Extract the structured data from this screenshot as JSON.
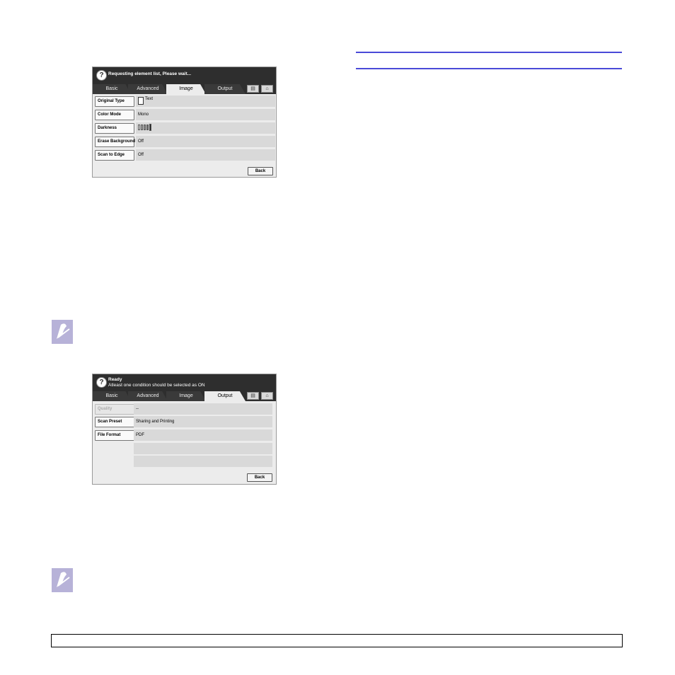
{
  "screen1": {
    "message": "Requesting element list, Please wait...",
    "tabs": [
      "Basic",
      "Advanced",
      "Image",
      "Output"
    ],
    "rows": [
      {
        "label": "Original Type",
        "value": "Text"
      },
      {
        "label": "Color Mode",
        "value": "Mono"
      },
      {
        "label": "Darkness",
        "value": ""
      },
      {
        "label": "Erase Background",
        "value": "Off"
      },
      {
        "label": "Scan to Edge",
        "value": "Off"
      }
    ],
    "back": "Back"
  },
  "screen2": {
    "status": "Ready",
    "message": "Atleast one condition should be selected as ON",
    "tabs": [
      "Basic",
      "Advanced",
      "Image",
      "Output"
    ],
    "rows": [
      {
        "label": "Quality",
        "value": "--"
      },
      {
        "label": "Scan Preset",
        "value": "Sharing and Printing"
      },
      {
        "label": "File Format",
        "value": "PDF"
      }
    ],
    "back": "Back"
  },
  "icons": [
    "help-icon",
    "job-status-icon",
    "home-icon",
    "note-icon",
    "document-icon"
  ],
  "colors": {
    "rule": "#4a4ad8",
    "note_icon": "#b7b2d8",
    "screen_bar": "#2e2e2e"
  }
}
